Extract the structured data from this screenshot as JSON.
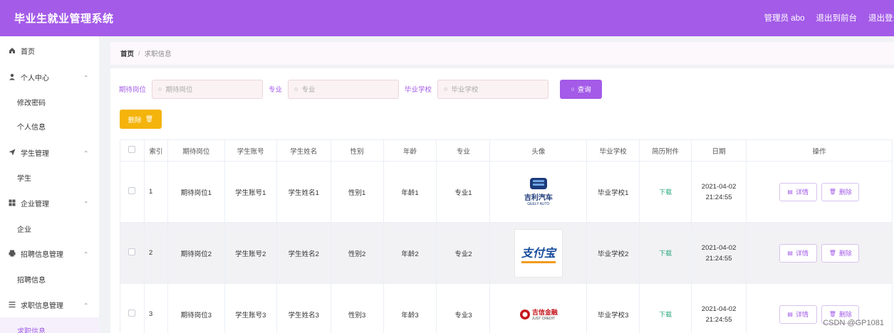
{
  "header": {
    "title": "毕业生就业管理系统",
    "admin": "管理员 abo",
    "back_front": "退出到前台",
    "logout": "退出登录"
  },
  "sidebar": {
    "home": "首页",
    "personal": "个人中心",
    "change_pwd": "修改密码",
    "personal_info": "个人信息",
    "student_mgmt": "学生管理",
    "student": "学生",
    "company_mgmt": "企业管理",
    "company": "企业",
    "recruit_mgmt": "招聘信息管理",
    "recruit": "招聘信息",
    "jobseek_mgmt": "求职信息管理",
    "jobseek": "求职信息"
  },
  "breadcrumb": {
    "home": "首页",
    "sep": "/",
    "current": "求职信息"
  },
  "search": {
    "position_label": "期待岗位",
    "position_placeholder": "期待岗位",
    "major_label": "专业",
    "major_placeholder": "专业",
    "school_label": "毕业学校",
    "school_placeholder": "毕业学校",
    "query": "查询"
  },
  "actions": {
    "delete": "删除"
  },
  "table": {
    "headers": [
      "索引",
      "期待岗位",
      "学生账号",
      "学生姓名",
      "性别",
      "年龄",
      "专业",
      "头像",
      "毕业学校",
      "简历附件",
      "日期",
      "操作"
    ],
    "download": "下载",
    "detail": "详情",
    "delete": "删除",
    "rows": [
      {
        "index": "1",
        "position": "期待岗位1",
        "account": "学生账号1",
        "name": "学生姓名1",
        "gender": "性别1",
        "age": "年龄1",
        "major": "专业1",
        "school": "毕业学校1",
        "date": "2021-04-02",
        "time": "21:24:55",
        "logo": "吉利汽车",
        "logo_sub": "GEELY AUTO"
      },
      {
        "index": "2",
        "position": "期待岗位2",
        "account": "学生账号2",
        "name": "学生姓名2",
        "gender": "性别2",
        "age": "年龄2",
        "major": "专业2",
        "school": "毕业学校2",
        "date": "2021-04-02",
        "time": "21:24:55",
        "logo": "支付宝",
        "logo_sub": ""
      },
      {
        "index": "3",
        "position": "期待岗位3",
        "account": "学生账号3",
        "name": "学生姓名3",
        "gender": "性别3",
        "age": "年龄3",
        "major": "专业3",
        "school": "毕业学校3",
        "date": "2021-04-02",
        "time": "21:24:55",
        "logo": "吉信金融",
        "logo_sub": "JUST CREDIT"
      }
    ]
  },
  "watermark": "CSDN @GP1081",
  "colors": {
    "accent": "#a45ce8",
    "warning": "#f5b40b",
    "download": "#2aa77f"
  }
}
